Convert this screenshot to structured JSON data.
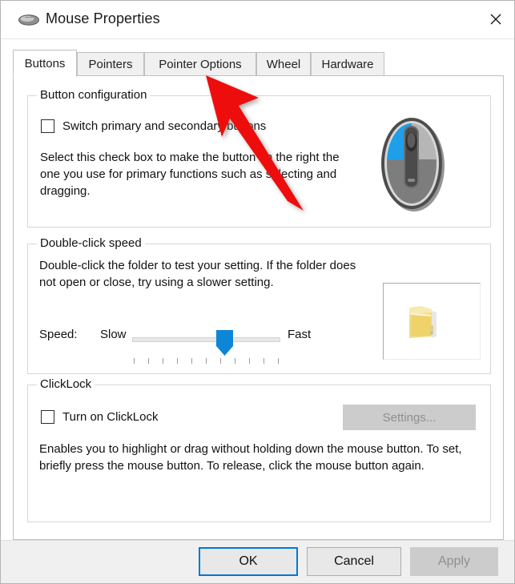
{
  "window": {
    "title": "Mouse Properties",
    "icon": "mouse-icon",
    "close_label": "✕"
  },
  "tabs": [
    {
      "label": "Buttons",
      "active": true
    },
    {
      "label": "Pointers",
      "active": false
    },
    {
      "label": "Pointer Options",
      "active": false
    },
    {
      "label": "Wheel",
      "active": false
    },
    {
      "label": "Hardware",
      "active": false
    }
  ],
  "button_configuration": {
    "group_title": "Button configuration",
    "checkbox_label": "Switch primary and secondary buttons",
    "checkbox_checked": false,
    "description": "Select this check box to make the button on the right the one you use for primary functions such as selecting and dragging.",
    "illustration": "mouse-illustration"
  },
  "double_click_speed": {
    "group_title": "Double-click speed",
    "description": "Double-click the folder to test your setting. If the folder does not open or close, try using a slower setting.",
    "speed_label": "Speed:",
    "slow_label": "Slow",
    "fast_label": "Fast",
    "slider_value": 57,
    "slider_min": 0,
    "slider_max": 100,
    "tick_count": 11,
    "test_icon": "folder-icon"
  },
  "click_lock": {
    "group_title": "ClickLock",
    "checkbox_label": "Turn on ClickLock",
    "checkbox_checked": false,
    "settings_button": "Settings...",
    "settings_enabled": false,
    "description": "Enables you to highlight or drag without holding down the mouse button. To set, briefly press the mouse button. To release, click the mouse button again."
  },
  "footer": {
    "ok_label": "OK",
    "cancel_label": "Cancel",
    "apply_label": "Apply",
    "apply_enabled": false
  },
  "annotation": {
    "type": "arrow",
    "color": "#ee1111",
    "points_to": "Pointer Options"
  },
  "colors": {
    "accent": "#0078d7",
    "annotation_red": "#ee1111",
    "mouse_highlight": "#1e9fe8",
    "folder_yellow": "#f0d97a"
  }
}
